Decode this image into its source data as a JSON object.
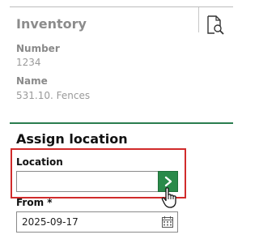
{
  "inventory": {
    "title": "Inventory",
    "number_label": "Number",
    "number_value": "1234",
    "name_label": "Name",
    "name_value": "531.10. Fences"
  },
  "assign": {
    "title": "Assign location",
    "location_label": "Location",
    "location_value": "",
    "location_placeholder": "",
    "from_label": "From *",
    "from_value": "2025-09-17"
  },
  "icons": {
    "preview": "document-search-icon",
    "go": "chevron-right-icon",
    "calendar": "calendar-icon",
    "cursor": "hand-pointer-icon"
  },
  "colors": {
    "accent_green": "#2a8a4a",
    "divider_green": "#2a7d4f",
    "highlight_red": "#d12b2b"
  }
}
